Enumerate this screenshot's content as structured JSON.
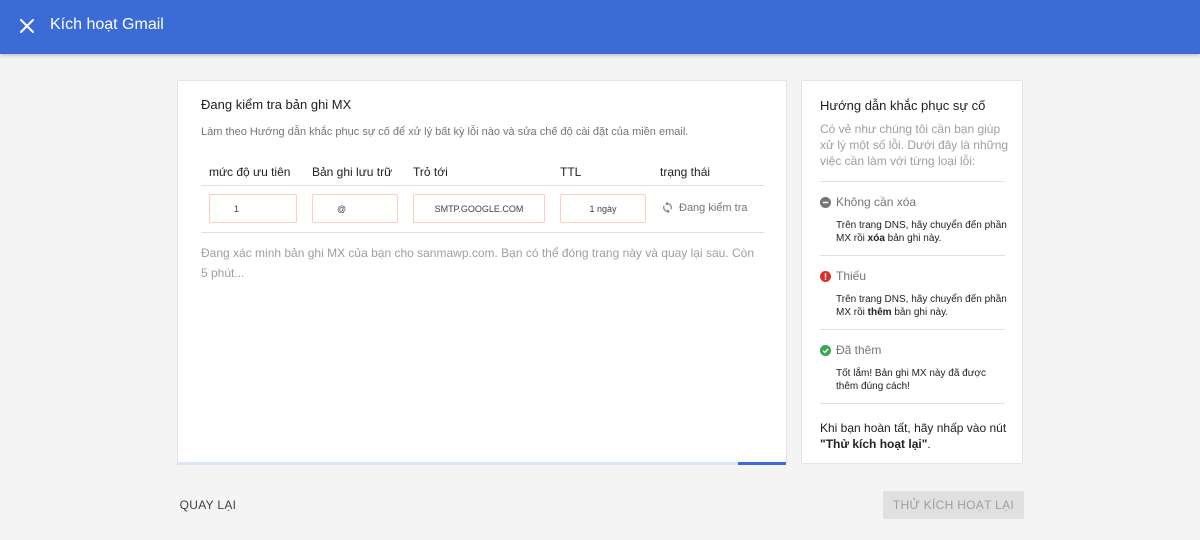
{
  "header": {
    "title": "Kích hoạt Gmail",
    "close_icon": "close-icon",
    "bg_color": "#3b6bd6"
  },
  "main": {
    "title": "Đang kiểm tra bản ghi MX",
    "description": "Làm theo Hướng dẫn khắc phục sự cố để xử lý bất kỳ lỗi nào và sửa chế độ cài đặt của miền email.",
    "columns": [
      "mức độ ưu tiên",
      "Bản ghi lưu trữ",
      "Trỏ tới",
      "TTL",
      "trạng thái"
    ],
    "row": {
      "priority": "1",
      "host": "@",
      "points_to": "SMTP.GOOGLE.COM",
      "ttl": "1 ngày",
      "status": "Đang kiểm tra",
      "status_icon": "refresh-icon"
    },
    "verify_text": "Đang xác minh bản ghi MX của bạn cho sanmawp.com. Bạn có thể đóng trang này và quay lại sau. Còn 5 phút...",
    "progress": 0.92
  },
  "sidebar": {
    "title": "Hướng dẫn khắc phục sự cố",
    "intro": "Có vẻ như chúng tôi cần bạn giúp xử lý một số lỗi. Dưới đây là những việc cần làm với từng loại lỗi:",
    "items": [
      {
        "label": "Không cần xóa",
        "icon": "minus-circle-icon",
        "color": "#757575",
        "text_before": "Trên trang DNS, hãy chuyển đến phần MX rồi ",
        "text_bold": "xóa",
        "text_after": " bản ghi này."
      },
      {
        "label": "Thiếu",
        "icon": "error-icon",
        "color": "#d93025",
        "text_before": "Trên trang DNS, hãy chuyển đến phần MX rồi ",
        "text_bold": "thêm",
        "text_after": " bản ghi này."
      },
      {
        "label": "Đã thêm",
        "icon": "check-circle-icon",
        "color": "#34a853",
        "text": "Tốt lắm! Bản ghi MX này đã được thêm đúng cách!"
      }
    ],
    "footer_before": "Khi bạn hoàn tất, hãy nhấp vào nút ",
    "footer_bold": "\"Thử kích hoạt lại\"",
    "footer_after": "."
  },
  "buttons": {
    "back": "QUAY LẠI",
    "retry": "THỬ KÍCH HOẠT LẠI"
  }
}
